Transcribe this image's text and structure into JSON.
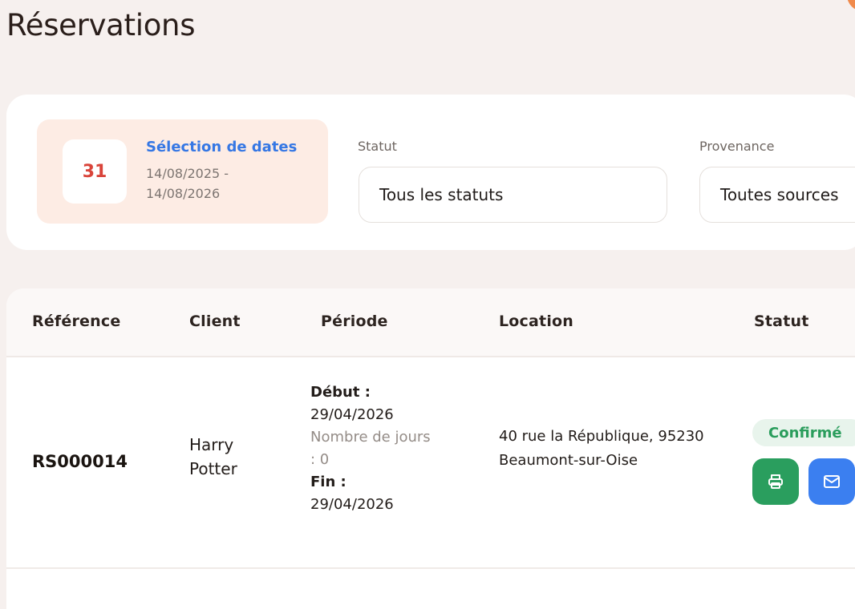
{
  "page": {
    "title": "Réservations"
  },
  "filters": {
    "date": {
      "day": "31",
      "label": "Sélection de dates",
      "range": "14/08/2025 - 14/08/2026"
    },
    "status": {
      "label": "Statut",
      "value": "Tous les statuts"
    },
    "source": {
      "label": "Provenance",
      "value": "Toutes sources"
    }
  },
  "table": {
    "columns": [
      "Référence",
      "Client",
      "Période",
      "Location",
      "Statut"
    ],
    "rows": [
      {
        "reference": "RS000014",
        "client": "Harry Potter",
        "period": {
          "start_label": "Début :",
          "start": "29/04/2026",
          "days_label": "Nombre de jours : 0",
          "end_label": "Fin :",
          "end": "29/04/2026"
        },
        "location": "40 rue la République, 95230 Beaumont-sur-Oise",
        "status": "Confirmé"
      }
    ]
  },
  "icons": {
    "print": "printer-icon",
    "email": "mail-icon"
  },
  "colors": {
    "accent": "#3577e4",
    "success": "#2a9e5e",
    "date_number": "#d9443a",
    "email_button": "#3b7ff0",
    "date_bg": "#fdece4"
  }
}
